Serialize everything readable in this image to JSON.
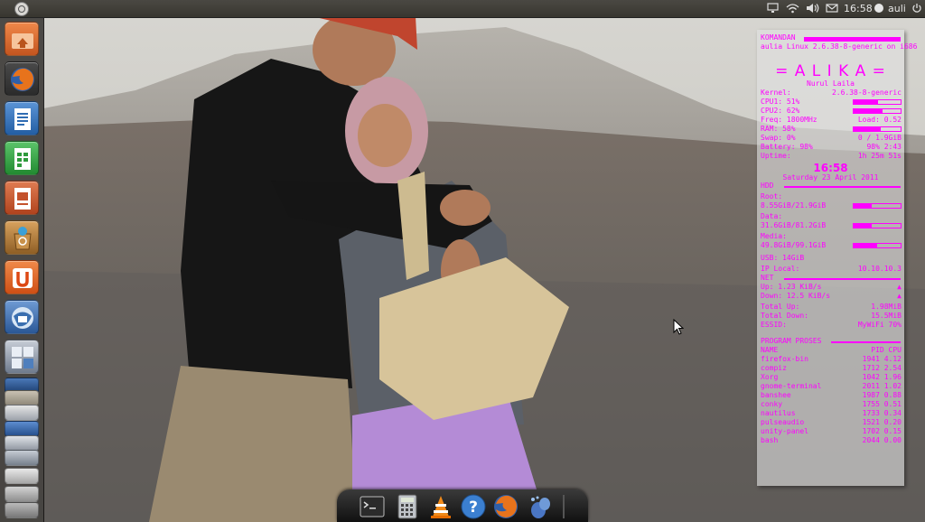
{
  "top_panel": {
    "clock": "16:58",
    "user": "auli"
  },
  "launcher": {
    "items": [
      {
        "name": "home-folder",
        "icon": "folder-home-icon",
        "color": "#e0702f"
      },
      {
        "name": "firefox",
        "icon": "firefox-icon",
        "color": "#e0652a"
      },
      {
        "name": "writer",
        "icon": "libreoffice-writer-icon",
        "color": "#2f6cb3"
      },
      {
        "name": "calc",
        "icon": "libreoffice-calc-icon",
        "color": "#2e9a3c"
      },
      {
        "name": "impress",
        "icon": "libreoffice-impress-icon",
        "color": "#c4522c"
      },
      {
        "name": "software-center",
        "icon": "software-center-icon",
        "color": "#b07a3a"
      },
      {
        "name": "ubuntu-one",
        "icon": "ubuntu-one-icon",
        "color": "#e06a2a"
      },
      {
        "name": "thunderbird",
        "icon": "thunderbird-icon",
        "color": "#3a6fb0"
      },
      {
        "name": "workspaces",
        "icon": "workspace-switcher-icon",
        "color": "#7a8ba0"
      }
    ]
  },
  "conky": {
    "header_label": "KOMANDAN",
    "system_line": "aulia Linux 2.6.38-8-generic on i686",
    "banner": "= A L I K A =",
    "subtitle": "Nurul Laila",
    "kernel_label": "Kernel:",
    "kernel_value": "2.6.38-8-generic",
    "cpu1_label": "CPU1: 51%",
    "cpu1_level": 0.51,
    "cpu2_label": "CPU2: 62%",
    "cpu2_level": 0.62,
    "freq_label": "Freq: 1800MHz",
    "freq_value": "Load: 0.52",
    "ram_label": "RAM: 58%",
    "ram_level": 0.58,
    "swap_label": "Swap: 0%",
    "swap_value": "0 / 1.9GiB",
    "battery_label": "Battery: 98%",
    "battery_value": "98% 2:43",
    "uptime_label": "Uptime:",
    "uptime_value": "1h 25m 51s",
    "time": "16:58",
    "date": "Saturday 23 April 2011",
    "hdd_heading": "HDD",
    "root_label": "Root:",
    "root_value": "8.55GiB/21.9GiB",
    "root_level": 0.39,
    "data_label": "Data:",
    "data_value": "31.6GiB/81.2GiB",
    "data_level": 0.39,
    "media_label": "Media:",
    "media_value": "49.8GiB/99.1GiB",
    "media_level": 0.5,
    "usb_label": "USB: 14GiB",
    "ip_label": "IP Local:",
    "ip_value": "10.10.10.3",
    "net_heading": "NET",
    "up_label": "Up: 1.23 KiB/s",
    "down_label": "Down: 12.5 KiB/s",
    "total_up_label": "Total Up:",
    "total_up_value": "1.98MiB",
    "total_down_label": "Total Down:",
    "total_down_value": "15.5MiB",
    "ssid_label": "ESSID:",
    "ssid_value": "MyWiFi 70%",
    "proc_heading": "PROGRAM PROSES",
    "proc_columns": [
      "NAME",
      "PID CPU"
    ],
    "processes": [
      {
        "name": "firefox-bin",
        "stats": "1941 4.12"
      },
      {
        "name": "compiz",
        "stats": "1712 2.54"
      },
      {
        "name": "Xorg",
        "stats": "1042 1.96"
      },
      {
        "name": "gnome-terminal",
        "stats": "2011 1.02"
      },
      {
        "name": "banshee",
        "stats": "1987 0.88"
      },
      {
        "name": "conky",
        "stats": "1755 0.51"
      },
      {
        "name": "nautilus",
        "stats": "1733 0.34"
      },
      {
        "name": "pulseaudio",
        "stats": "1521 0.20"
      },
      {
        "name": "unity-panel",
        "stats": "1702 0.15"
      },
      {
        "name": "bash",
        "stats": "2044 0.00"
      }
    ]
  },
  "dock": {
    "items": [
      "terminal-icon",
      "calculator-icon",
      "vlc-icon",
      "help-icon",
      "firefox-icon",
      "pidgin-icon"
    ]
  }
}
